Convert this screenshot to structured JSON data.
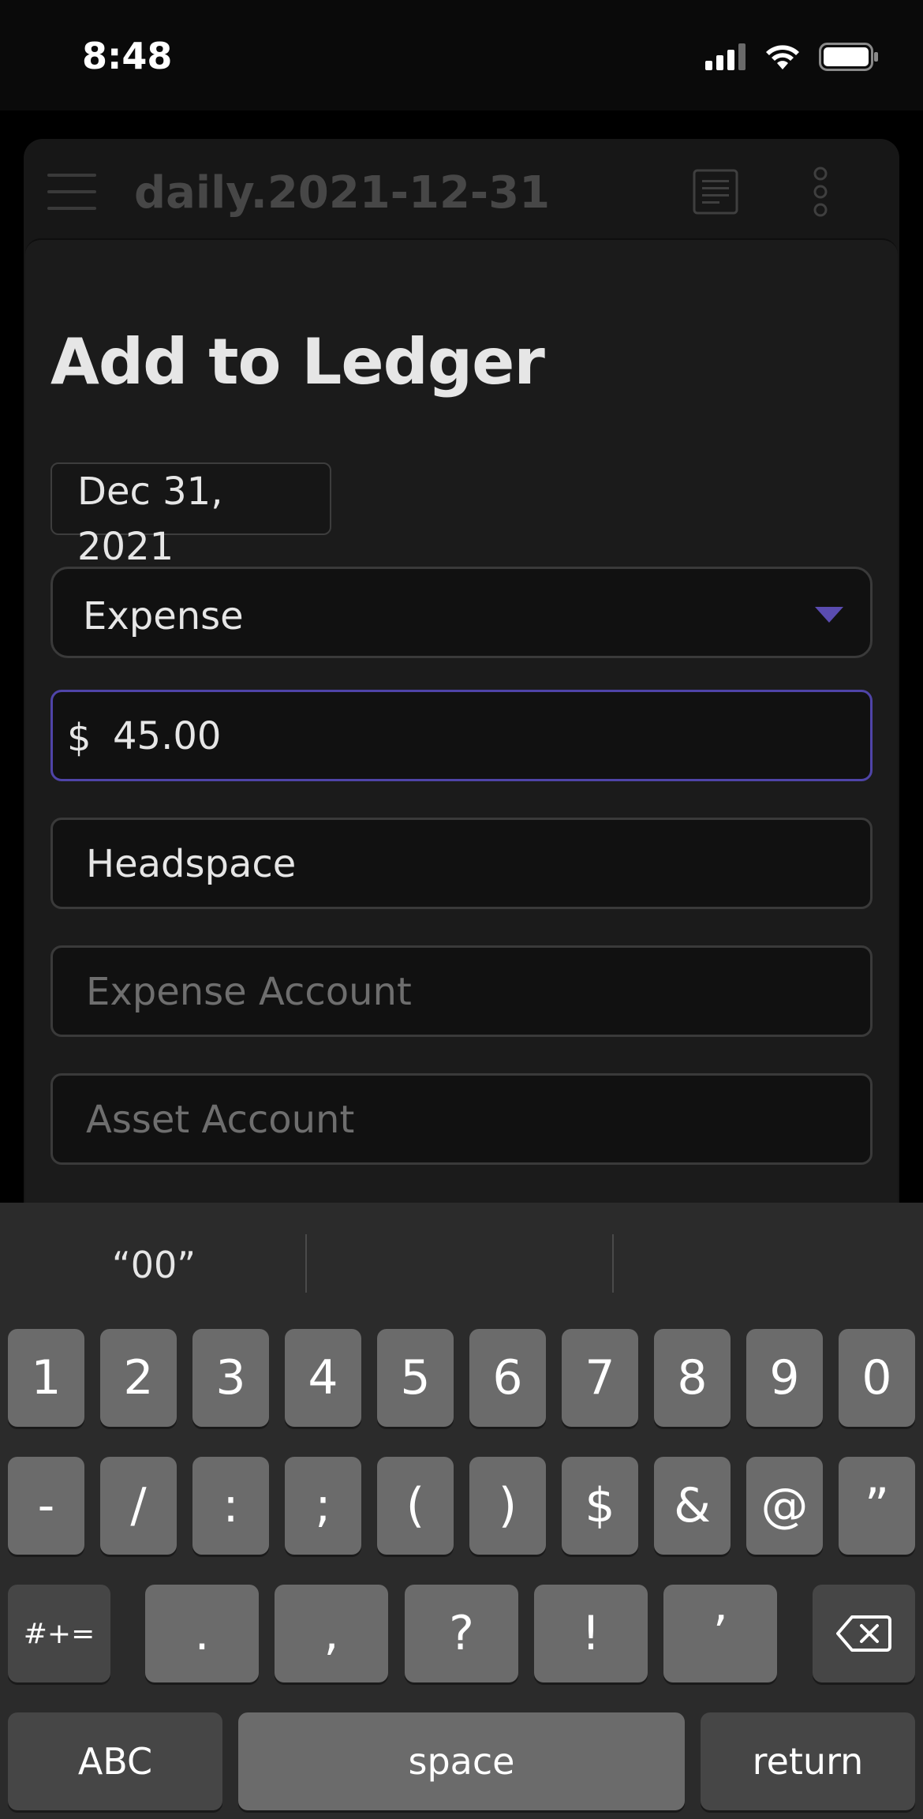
{
  "status": {
    "time": "8:48"
  },
  "note": {
    "title": "daily.2021-12-31"
  },
  "sheet": {
    "title": "Add to Ledger",
    "date": "Dec 31, 2021",
    "type_selected": "Expense",
    "currency_symbol": "$",
    "amount": "45.00",
    "payee": "Headspace",
    "expense_account_placeholder": "Expense Account",
    "asset_account_placeholder": "Asset Account",
    "accent_color": "#5a4cb0"
  },
  "keyboard": {
    "suggestions": [
      "“00”",
      "",
      ""
    ],
    "row1": [
      "1",
      "2",
      "3",
      "4",
      "5",
      "6",
      "7",
      "8",
      "9",
      "0"
    ],
    "row2": [
      "-",
      "/",
      ":",
      ";",
      "(",
      ")",
      "$",
      "&",
      "@",
      "”"
    ],
    "row3_mode": "#+=",
    "row3": [
      ".",
      ",",
      "?",
      "!",
      "’"
    ],
    "abc": "ABC",
    "space": "space",
    "return": "return"
  }
}
